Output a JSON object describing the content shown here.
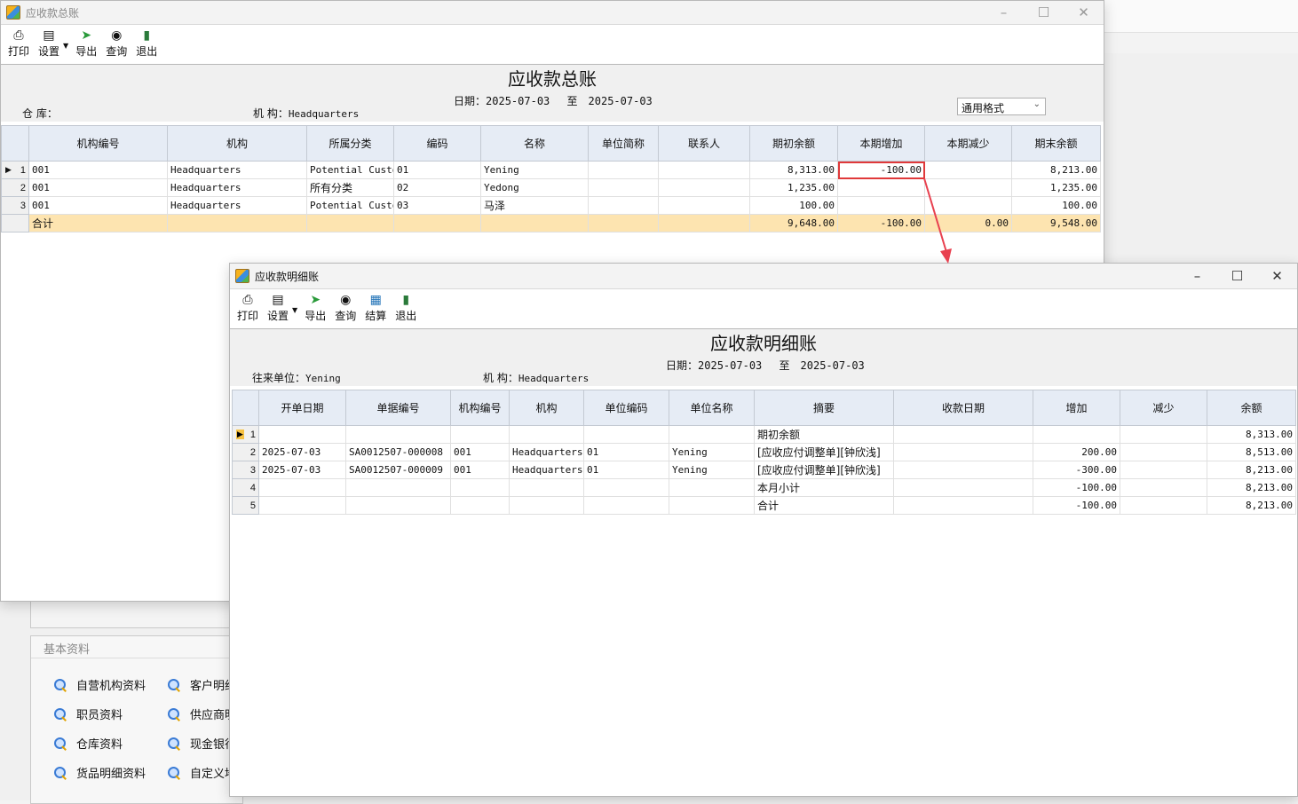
{
  "background": {
    "panel_title": "基本资料",
    "links": [
      {
        "label": "自营机构资料"
      },
      {
        "label": "客户明细"
      },
      {
        "label": "职员资料"
      },
      {
        "label": "供应商明"
      },
      {
        "label": "仓库资料"
      },
      {
        "label": "现金银行"
      },
      {
        "label": "货品明细资料"
      },
      {
        "label": "自定义地"
      }
    ]
  },
  "summary_window": {
    "title": "应收款总账",
    "toolbar": {
      "print": "打印",
      "settings": "设置",
      "export": "导出",
      "query": "查询",
      "exit": "退出"
    },
    "report_title": "应收款总账",
    "date_label": "日期：",
    "date_from": "2025-07-03",
    "date_to_label": "至",
    "date_to": "2025-07-03",
    "warehouse_label": "仓    库：",
    "org_label": "机    构：",
    "org_value": "Headquarters",
    "format_select": "通用格式",
    "columns": [
      "机构编号",
      "机构",
      "所属分类",
      "编码",
      "名称",
      "单位简称",
      "联系人",
      "期初余额",
      "本期增加",
      "本期减少",
      "期末余额"
    ],
    "rows": [
      {
        "no": "1",
        "org_code": "001",
        "org": "Headquarters",
        "category": "Potential Custom",
        "code": "01",
        "name": "Yening",
        "short": "",
        "contact": "",
        "opening": "8,313.00",
        "increase": "-100.00",
        "decrease": "",
        "closing": "8,213.00"
      },
      {
        "no": "2",
        "org_code": "001",
        "org": "Headquarters",
        "category": "所有分类",
        "code": "02",
        "name": "Yedong",
        "short": "",
        "contact": "",
        "opening": "1,235.00",
        "increase": "",
        "decrease": "",
        "closing": "1,235.00"
      },
      {
        "no": "3",
        "org_code": "001",
        "org": "Headquarters",
        "category": "Potential Custom",
        "code": "03",
        "name": "马泽",
        "short": "",
        "contact": "",
        "opening": "100.00",
        "increase": "",
        "decrease": "",
        "closing": "100.00"
      }
    ],
    "total": {
      "label": "合计",
      "opening": "9,648.00",
      "increase": "-100.00",
      "decrease": "0.00",
      "closing": "9,548.00"
    }
  },
  "detail_window": {
    "title": "应收款明细账",
    "toolbar": {
      "print": "打印",
      "settings": "设置",
      "export": "导出",
      "query": "查询",
      "settle": "结算",
      "exit": "退出"
    },
    "report_title": "应收款明细账",
    "date_label": "日期：",
    "date_from": "2025-07-03",
    "date_to_label": "至",
    "date_to": "2025-07-03",
    "partner_label": "往来单位：",
    "partner_value": "Yening",
    "org_label": "机    构：",
    "org_value": "Headquarters",
    "columns": [
      "开单日期",
      "单据编号",
      "机构编号",
      "机构",
      "单位编码",
      "单位名称",
      "摘要",
      "收款日期",
      "增加",
      "减少",
      "余额"
    ],
    "rows": [
      {
        "no": "1",
        "date": "",
        "doc": "",
        "org_code": "",
        "org": "",
        "unit_code": "",
        "unit_name": "",
        "summary": "期初余额",
        "pay_date": "",
        "increase": "",
        "decrease": "",
        "balance": "8,313.00"
      },
      {
        "no": "2",
        "date": "2025-07-03",
        "doc": "SA0012507-000008",
        "org_code": "001",
        "org": "Headquarters",
        "unit_code": "01",
        "unit_name": "Yening",
        "summary": "[应收应付调整单][钟欣浅]",
        "pay_date": "",
        "increase": "200.00",
        "decrease": "",
        "balance": "8,513.00"
      },
      {
        "no": "3",
        "date": "2025-07-03",
        "doc": "SA0012507-000009",
        "org_code": "001",
        "org": "Headquarters",
        "unit_code": "01",
        "unit_name": "Yening",
        "summary": "[应收应付调整单][钟欣浅]",
        "pay_date": "",
        "increase": "-300.00",
        "decrease": "",
        "balance": "8,213.00"
      },
      {
        "no": "4",
        "date": "",
        "doc": "",
        "org_code": "",
        "org": "",
        "unit_code": "",
        "unit_name": "",
        "summary": "本月小计",
        "pay_date": "",
        "increase": "-100.00",
        "decrease": "",
        "balance": "8,213.00"
      },
      {
        "no": "5",
        "date": "",
        "doc": "",
        "org_code": "",
        "org": "",
        "unit_code": "",
        "unit_name": "",
        "summary": "合计",
        "pay_date": "",
        "increase": "-100.00",
        "decrease": "",
        "balance": "8,213.00"
      }
    ]
  },
  "colors": {
    "header_bg": "#e6ecf5",
    "total_row": "#fde4b0",
    "highlight": "#e0393a"
  }
}
